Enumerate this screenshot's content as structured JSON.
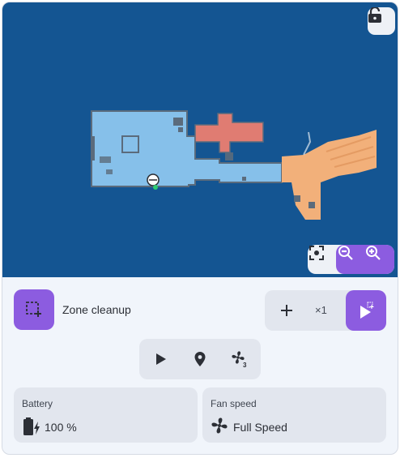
{
  "map": {
    "lock_icon": "lock-open-icon",
    "zoom_fit_icon": "focus-icon",
    "zoom_out_icon": "zoom-out-icon",
    "zoom_in_icon": "zoom-in-icon",
    "colors": {
      "background": "#145592",
      "room_blue": "#86c0ea",
      "room_red": "#e07c72",
      "room_orange": "#f2b07a",
      "wall": "#5b6b7c"
    }
  },
  "zone": {
    "label": "Zone cleanup",
    "icon": "zone-select-icon"
  },
  "repeat": {
    "add_icon": "plus-icon",
    "count": "×1",
    "start_icon": "play-zone-icon"
  },
  "controls": {
    "play_icon": "play-icon",
    "goto_icon": "map-marker-icon",
    "fan_icon": "fan-speed-3-icon"
  },
  "battery": {
    "title": "Battery",
    "value": "100 %",
    "icon": "battery-charging-icon"
  },
  "fan": {
    "title": "Fan speed",
    "value": "Full Speed",
    "icon": "fan-icon"
  },
  "accent": "#8c5ce0"
}
